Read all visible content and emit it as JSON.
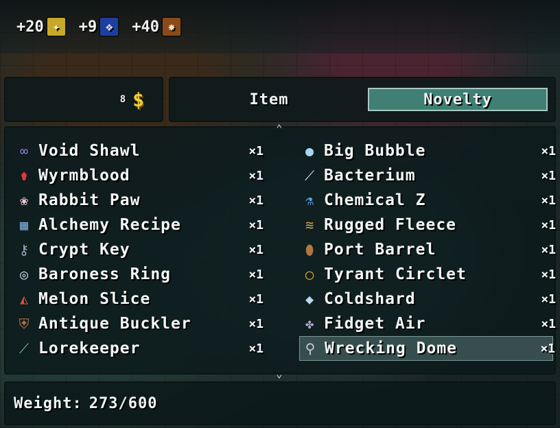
{
  "resources": [
    {
      "amount": "+20",
      "icon": "star-burst-icon",
      "color": "#c7a82a"
    },
    {
      "amount": "+9",
      "icon": "blue-crest-icon",
      "color": "#1d3f9e"
    },
    {
      "amount": "+40",
      "icon": "flame-slash-icon",
      "color": "#8a4a1a"
    }
  ],
  "money": {
    "count": "8",
    "sign": "$"
  },
  "tabs": {
    "item": "Item",
    "novelty": "Novelty",
    "active": "Novelty"
  },
  "items_left": [
    {
      "name": "Void Shawl",
      "qty": "×1",
      "icon": "shawl-icon"
    },
    {
      "name": "Wyrmblood",
      "qty": "×1",
      "icon": "potion-icon"
    },
    {
      "name": "Rabbit Paw",
      "qty": "×1",
      "icon": "paw-icon"
    },
    {
      "name": "Alchemy Recipe",
      "qty": "×1",
      "icon": "recipe-icon"
    },
    {
      "name": "Crypt Key",
      "qty": "×1",
      "icon": "key-icon"
    },
    {
      "name": "Baroness Ring",
      "qty": "×1",
      "icon": "ring-icon"
    },
    {
      "name": "Melon Slice",
      "qty": "×1",
      "icon": "melon-icon"
    },
    {
      "name": "Antique Buckler",
      "qty": "×1",
      "icon": "shield-icon"
    },
    {
      "name": "Lorekeeper",
      "qty": "×1",
      "icon": "staff-icon"
    }
  ],
  "items_right": [
    {
      "name": "Big Bubble",
      "qty": "×1",
      "icon": "bubble-icon"
    },
    {
      "name": "Bacterium",
      "qty": "×1",
      "icon": "vial-icon"
    },
    {
      "name": "Chemical Z",
      "qty": "×1",
      "icon": "flask-icon"
    },
    {
      "name": "Rugged Fleece",
      "qty": "×1",
      "icon": "fleece-icon"
    },
    {
      "name": "Port Barrel",
      "qty": "×1",
      "icon": "barrel-icon"
    },
    {
      "name": "Tyrant Circlet",
      "qty": "×1",
      "icon": "circlet-icon"
    },
    {
      "name": "Coldshard",
      "qty": "×1",
      "icon": "crystal-icon"
    },
    {
      "name": "Fidget Air",
      "qty": "×1",
      "icon": "spinner-icon"
    },
    {
      "name": "Wrecking Dome",
      "qty": "×1",
      "icon": "mace-icon",
      "selected": true
    }
  ],
  "weight": {
    "label": "Weight:",
    "value": "273/600"
  }
}
